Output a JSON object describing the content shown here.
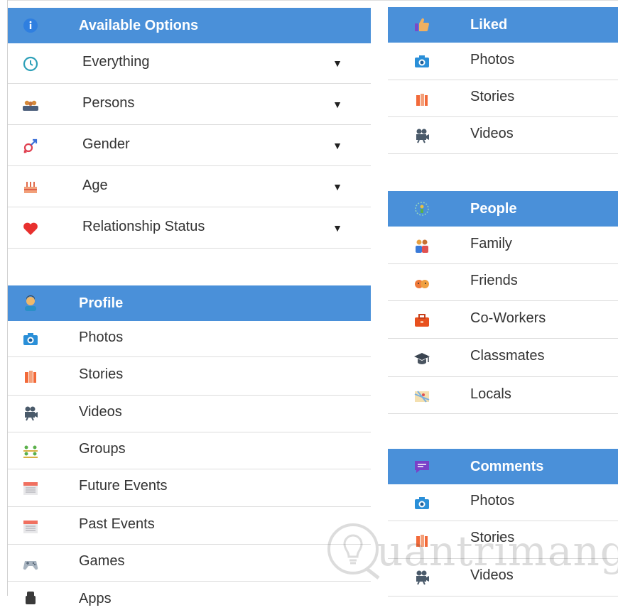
{
  "available_options": {
    "title": "Available Options",
    "items": [
      {
        "label": "Everything",
        "caret": "▼"
      },
      {
        "label": "Persons",
        "caret": "▼"
      },
      {
        "label": "Gender",
        "caret": "▼"
      },
      {
        "label": "Age",
        "caret": "▼"
      },
      {
        "label": "Relationship Status",
        "caret": "▼"
      }
    ]
  },
  "profile": {
    "title": "Profile",
    "items": [
      {
        "label": "Photos"
      },
      {
        "label": "Stories"
      },
      {
        "label": "Videos"
      },
      {
        "label": "Groups"
      },
      {
        "label": "Future Events"
      },
      {
        "label": "Past Events"
      },
      {
        "label": "Games"
      },
      {
        "label": "Apps"
      }
    ]
  },
  "liked": {
    "title": "Liked",
    "items": [
      {
        "label": "Photos"
      },
      {
        "label": "Stories"
      },
      {
        "label": "Videos"
      }
    ]
  },
  "people": {
    "title": "People",
    "items": [
      {
        "label": "Family"
      },
      {
        "label": "Friends"
      },
      {
        "label": "Co-Workers"
      },
      {
        "label": "Classmates"
      },
      {
        "label": "Locals"
      }
    ]
  },
  "comments": {
    "title": "Comments",
    "items": [
      {
        "label": "Photos"
      },
      {
        "label": "Stories"
      },
      {
        "label": "Videos"
      }
    ]
  },
  "watermark": {
    "text": "uantrimang"
  },
  "colors": {
    "header_bg": "#4a90d9",
    "header_text": "#ffffff",
    "row_border": "#dcdcdc"
  }
}
